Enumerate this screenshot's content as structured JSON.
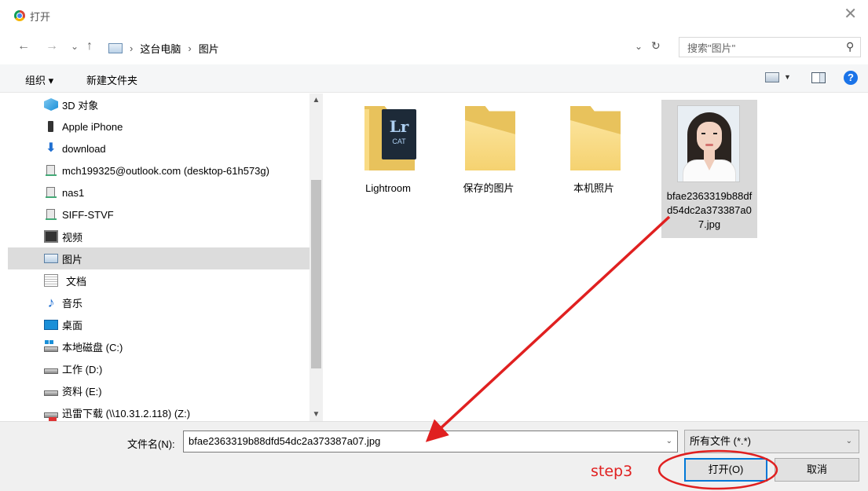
{
  "window": {
    "title": "打开",
    "close_glyph": "✕"
  },
  "nav": {
    "back": "←",
    "forward": "→",
    "recent": "⌄",
    "up": "↑",
    "breadcrumb": [
      "这台电脑",
      "图片"
    ],
    "separator": "›",
    "address_dropdown": "⌄",
    "refresh": "↻"
  },
  "search": {
    "placeholder": "搜索\"图片\"",
    "icon": "⚲"
  },
  "toolbar": {
    "organize": "组织 ▾",
    "new_folder": "新建文件夹",
    "view_dropdown": "▼",
    "help": "?"
  },
  "tree": {
    "items": [
      {
        "label": "3D 对象",
        "icon": "3d-objects-icon"
      },
      {
        "label": "Apple iPhone",
        "icon": "phone-icon"
      },
      {
        "label": "download",
        "icon": "download-arrow-icon"
      },
      {
        "label": "mch199325@outlook.com (desktop-61h573g)",
        "icon": "network-share-icon"
      },
      {
        "label": "nas1",
        "icon": "network-share-icon"
      },
      {
        "label": "SIFF-STVF",
        "icon": "network-share-icon"
      },
      {
        "label": "视频",
        "icon": "video-icon"
      },
      {
        "label": "图片",
        "icon": "pictures-icon",
        "selected": true
      },
      {
        "label": "文档",
        "icon": "documents-icon"
      },
      {
        "label": "音乐",
        "icon": "music-icon"
      },
      {
        "label": "桌面",
        "icon": "desktop-icon"
      },
      {
        "label": "本地磁盘 (C:)",
        "icon": "system-drive-icon"
      },
      {
        "label": "工作 (D:)",
        "icon": "drive-icon"
      },
      {
        "label": "资料 (E:)",
        "icon": "drive-icon"
      },
      {
        "label": "迅雷下载 (\\\\10.31.2.118) (Z:)",
        "icon": "network-drive-icon"
      }
    ],
    "scroll_up": "▲",
    "scroll_down": "▼"
  },
  "files": {
    "items": [
      {
        "label": "Lightroom",
        "type": "folder",
        "badge_big": "Lr",
        "badge_small": "CAT"
      },
      {
        "label": "保存的图片",
        "type": "folder"
      },
      {
        "label": "本机照片",
        "type": "folder"
      },
      {
        "label": "bfae2363319b88dfd54dc2a373387a07.jpg",
        "type": "image",
        "selected": true
      }
    ]
  },
  "footer": {
    "filename_label": "文件名(N):",
    "filename_value": "bfae2363319b88dfd54dc2a373387a07.jpg",
    "filetype_value": "所有文件 (*.*)",
    "dropdown_glyph": "⌄",
    "open_button": "打开(O)",
    "cancel_button": "取消"
  },
  "annotation": {
    "step_label": "step3",
    "color": "#e02020"
  }
}
